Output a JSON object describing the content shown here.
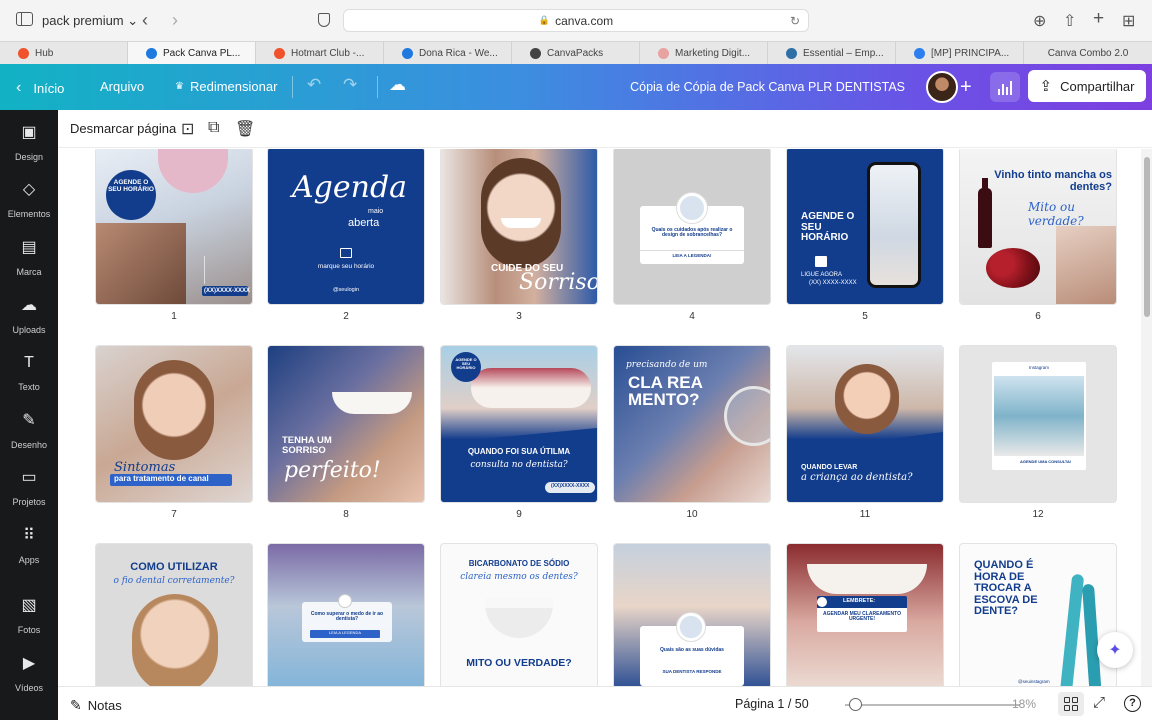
{
  "browser": {
    "profile": "pack premium",
    "address": "canva.com",
    "tabs": [
      {
        "label": "Hub",
        "color": "#f0522c"
      },
      {
        "label": "Pack Canva PL...",
        "color": "#1f7ae0",
        "active": true
      },
      {
        "label": "Hotmart Club -...",
        "color": "#f0522c"
      },
      {
        "label": "Dona Rica - We...",
        "color": "#1f7ae0"
      },
      {
        "label": "CanvaPacks",
        "color": "#444444"
      },
      {
        "label": "Marketing Digit...",
        "color": "#e7a3a0"
      },
      {
        "label": "Essential – Emp...",
        "color": "#2f6fa8"
      },
      {
        "label": "[MP] PRINCIPA...",
        "color": "#2d7ff0"
      },
      {
        "label": "Canva Combo 2.0",
        "color": ""
      }
    ]
  },
  "header": {
    "home": "Início",
    "file": "Arquivo",
    "resize": "Redimensionar",
    "doc_title": "Cópia de Cópia de Pack Canva PLR DENTISTAS",
    "share": "Compartilhar"
  },
  "rail": [
    {
      "label": "Design",
      "icon": "layout-icon"
    },
    {
      "label": "Elementos",
      "icon": "shapes-icon"
    },
    {
      "label": "Marca",
      "icon": "brand-icon"
    },
    {
      "label": "Uploads",
      "icon": "cloud-upload-icon"
    },
    {
      "label": "Texto",
      "icon": "text-icon"
    },
    {
      "label": "Desenho",
      "icon": "pen-icon"
    },
    {
      "label": "Projetos",
      "icon": "folder-icon"
    },
    {
      "label": "Apps",
      "icon": "apps-icon"
    },
    {
      "label": "Fotos",
      "icon": "photo-icon"
    },
    {
      "label": "Vídeos",
      "icon": "video-icon"
    }
  ],
  "toolbar": {
    "deselect": "Desmarcar página"
  },
  "pages": {
    "p1": {
      "num": "1",
      "t1": "AGENDE O SEU HORÁRIO",
      "t2": "(XX)XXXX-XXXX"
    },
    "p2": {
      "num": "2",
      "t1": "Agenda",
      "t2": "maio",
      "t3": "aberta",
      "t4": "marque seu horário",
      "t5": "@seulogin"
    },
    "p3": {
      "num": "3",
      "t1": "CUIDE DO SEU",
      "t2": "Sorriso!"
    },
    "p4": {
      "num": "4",
      "t1": "Quais os cuidados após realizar o design de sobrancelhas?",
      "t2": "LEIA A LEGENDA!"
    },
    "p5": {
      "num": "5",
      "t1": "AGENDE O SEU HORÁRIO",
      "t2": "LIGUE AGORA",
      "t3": "(XX) XXXX-XXXX"
    },
    "p6": {
      "num": "6",
      "t1": "Vinho tinto mancha os dentes?",
      "t2": "Mito ou verdade?"
    },
    "p7": {
      "num": "7",
      "t1": "Sintomas",
      "t2": "para tratamento de canal"
    },
    "p8": {
      "num": "8",
      "t1": "TENHA UM SORRISO",
      "t2": "perfeito!"
    },
    "p9": {
      "num": "9",
      "t1": "AGENDE O SEU HORÁRIO",
      "t2": "QUANDO FOI SUA ÚTILMA",
      "t3": "consulta no dentista?",
      "t4": "(XX)XXXX-XXXX"
    },
    "p10": {
      "num": "10",
      "t1": "precisando de um",
      "t2": "CLA REA MENTO?"
    },
    "p11": {
      "num": "11",
      "t1": "QUANDO LEVAR",
      "t2": "a criança ao dentista?"
    },
    "p12": {
      "num": "12",
      "t1": "Instagram",
      "t2": "AGENDE UMA CONSULTA!"
    },
    "p13": {
      "num": "",
      "t1": "COMO UTILIZAR",
      "t2": "o fio dental corretamente?"
    },
    "p14": {
      "num": "",
      "t1": "Como superar o medo de ir ao dentista?",
      "t2": "LEIA A LEGENDA"
    },
    "p15": {
      "num": "",
      "t1": "BICARBONATO DE SÓDIO",
      "t2": "clareia mesmo os dentes?",
      "t3": "MITO OU VERDADE?"
    },
    "p16": {
      "num": "",
      "t1": "Quais são as suas dúvidas",
      "t2": "SUA DENTISTA RESPONDE"
    },
    "p17": {
      "num": "",
      "t1": "LEMBRETE:",
      "t2": "AGENDAR MEU CLAREAMENTO URGENTE!"
    },
    "p18": {
      "num": "",
      "t1": "QUANDO É HORA DE TROCAR A ESCOVA DE DENTE?",
      "t2": "@seuinstagram"
    }
  },
  "bottom": {
    "notes": "Notas",
    "page_indicator": "Página 1 / 50",
    "zoom": "18%",
    "zoom_fraction": 0.04
  },
  "colors": {
    "navy": "#123c8c",
    "accent_blue": "#2d63c8",
    "share_bg": "#ffffff"
  }
}
